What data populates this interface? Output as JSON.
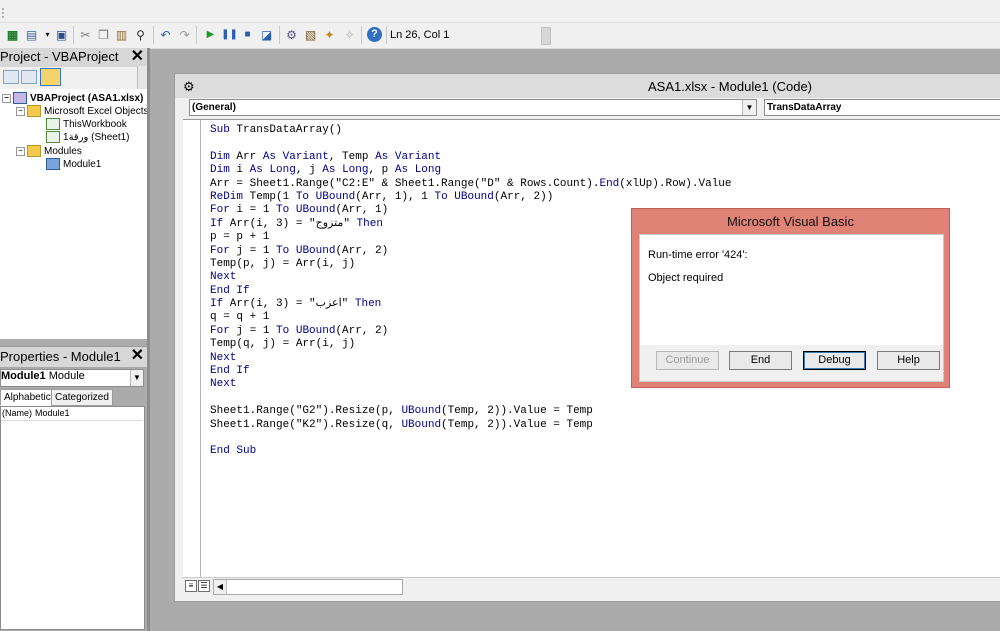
{
  "toolbar": {
    "status": "Ln 26, Col 1",
    "icons": [
      "excel-icon",
      "insert-userform-icon",
      "save-icon",
      "cut-icon",
      "copy-icon",
      "paste-icon",
      "find-icon",
      "undo-icon",
      "redo-icon",
      "run-icon",
      "break-icon",
      "reset-icon",
      "design-mode-icon",
      "project-explorer-icon",
      "properties-icon",
      "object-browser-icon",
      "toolbox-icon",
      "help-icon"
    ]
  },
  "project": {
    "title": "Project - VBAProject",
    "tree": [
      {
        "label": "VBAProject (ASA1.xlsx)"
      },
      {
        "label": "Microsoft Excel Objects"
      },
      {
        "label": "ThisWorkbook"
      },
      {
        "label": "ورقة1 (Sheet1)"
      },
      {
        "label": "Modules"
      },
      {
        "label": "Module1"
      }
    ]
  },
  "properties": {
    "title": "Properties - Module1",
    "object_name": "Module1",
    "object_type": "Module",
    "tabs": [
      "Alphabetic",
      "Categorized"
    ],
    "row_key": "(Name)",
    "row_value": "Module1"
  },
  "code_window": {
    "title": "ASA1.xlsx - Module1 (Code)",
    "object_combo": "(General)",
    "proc_combo": "TransDataArray",
    "lines": [
      "Sub TransDataArray()",
      "",
      "Dim Arr As Variant, Temp As Variant",
      "Dim i As Long, j As Long, p As Long",
      "Arr = Sheet1.Range(\"C2:E\" & Sheet1.Range(\"D\" & Rows.Count).End(xlUp).Row).Value",
      "ReDim Temp(1 To UBound(Arr, 1), 1 To UBound(Arr, 2))",
      "For i = 1 To UBound(Arr, 1)",
      "If Arr(i, 3) = \"متزوج\" Then",
      "p = p + 1",
      "For j = 1 To UBound(Arr, 2)",
      "Temp(p, j) = Arr(i, j)",
      "Next",
      "End If",
      "If Arr(i, 3) = \"اعزب\" Then",
      "q = q + 1",
      "For j = 1 To UBound(Arr, 2)",
      "Temp(q, j) = Arr(i, j)",
      "Next",
      "End If",
      "Next",
      "",
      "Sheet1.Range(\"G2\").Resize(p, UBound(Temp, 2)).Value = Temp",
      "Sheet1.Range(\"K2\").Resize(q, UBound(Temp, 2)).Value = Temp",
      "",
      "End Sub"
    ]
  },
  "dialog": {
    "title": "Microsoft Visual Basic",
    "error": "Run-time error '424':",
    "message": "Object required",
    "buttons": [
      "Continue",
      "End",
      "Debug",
      "Help"
    ]
  },
  "colors": {
    "keyword": "#00008b",
    "dialog_frame": "#e08276"
  }
}
